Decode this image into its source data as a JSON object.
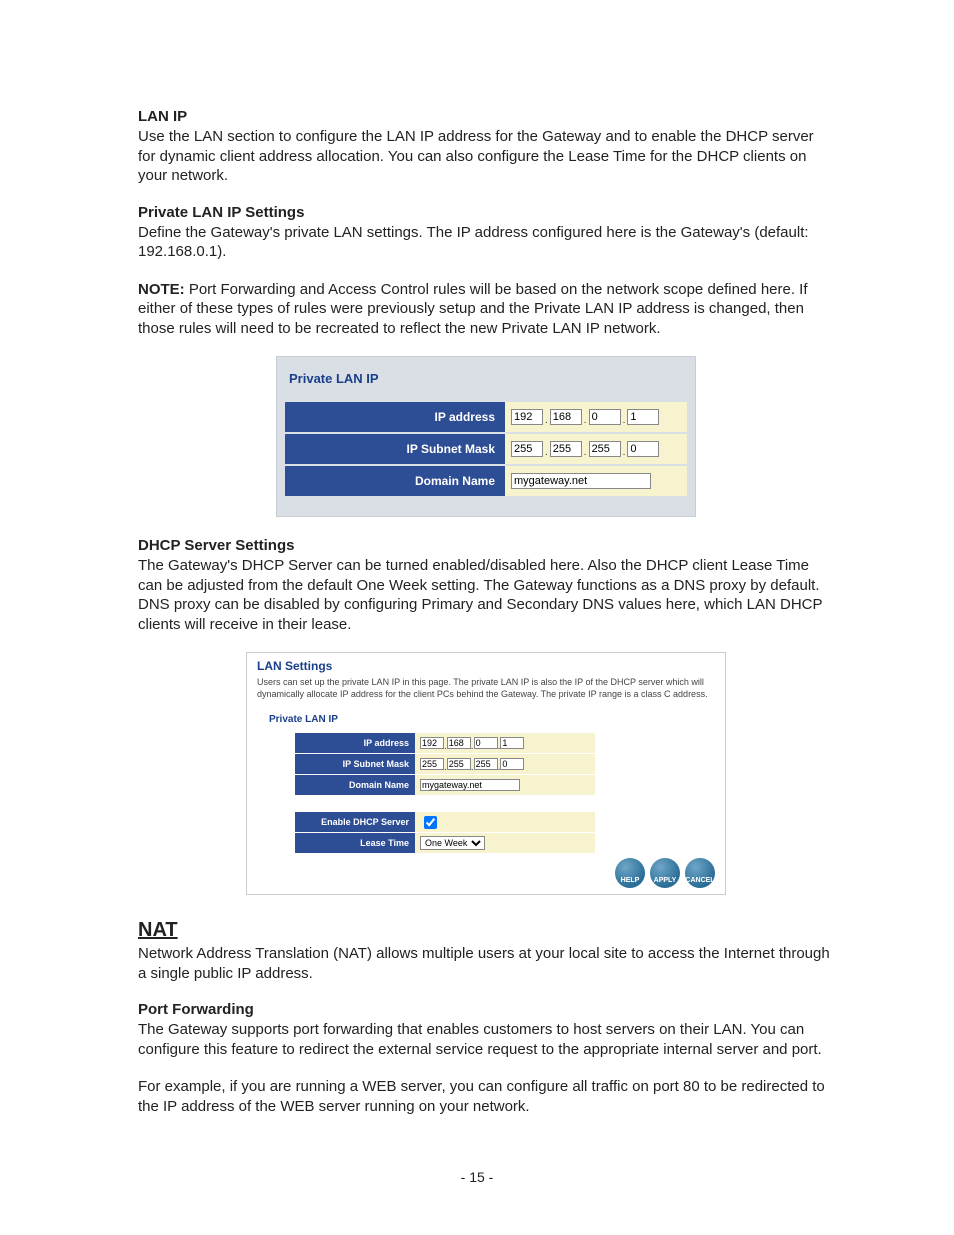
{
  "sections": {
    "lan_ip": {
      "heading": "LAN IP",
      "body": "Use the LAN section to configure the LAN IP address for the Gateway and to enable the DHCP server for dynamic client address allocation. You can also configure the Lease Time for the DHCP clients on your network."
    },
    "private_lan": {
      "heading": "Private LAN IP Settings",
      "body": "Define the Gateway's private LAN settings.  The IP address configured here is the Gateway's (default: 192.168.0.1)."
    },
    "note": {
      "label": "NOTE:",
      "body": " Port Forwarding and Access Control rules will be based on the network scope defined here.  If either of these types of rules were previously setup and the Private LAN IP address is changed, then those rules will need to be recreated to reflect the new Private LAN IP network."
    },
    "dhcp": {
      "heading": "DHCP Server Settings",
      "body": "The Gateway's DHCP Server can be turned enabled/disabled here.  Also the DHCP client Lease Time can be adjusted from the default One Week setting.  The Gateway functions as a DNS proxy by default.  DNS proxy can be disabled by configuring Primary and Secondary DNS values here, which LAN DHCP clients will receive in their lease."
    },
    "nat": {
      "heading": "NAT",
      "body": "Network Address Translation (NAT) allows multiple users at your local site to access the Internet through a single public IP address."
    },
    "portfw": {
      "heading": "Port Forwarding",
      "body1": "The Gateway supports port forwarding that enables customers to host servers on their LAN. You can configure this feature to redirect the external service request to the appropriate internal server and port.",
      "body2": "For example, if you are running a WEB server, you can configure all traffic on port 80 to be redirected to the IP address of the WEB server running on your network."
    }
  },
  "figure1": {
    "title": "Private LAN IP",
    "rows": {
      "ip_label": "IP address",
      "mask_label": "IP Subnet Mask",
      "domain_label": "Domain Name",
      "ip": [
        "192",
        "168",
        "0",
        "1"
      ],
      "mask": [
        "255",
        "255",
        "255",
        "0"
      ],
      "domain": "mygateway.net"
    }
  },
  "figure2": {
    "title": "LAN Settings",
    "desc": "Users can set up the private LAN IP in this page. The private LAN IP is also the IP of the DHCP server which will dynamically allocate IP address for the client PCs behind the Gateway. The private IP range is a class C address.",
    "sub": "Private LAN IP",
    "rows": {
      "ip_label": "IP address",
      "mask_label": "IP Subnet Mask",
      "domain_label": "Domain Name",
      "dhcp_label": "Enable DHCP Server",
      "lease_label": "Lease Time",
      "ip": [
        "192",
        "168",
        "0",
        "1"
      ],
      "mask": [
        "255",
        "255",
        "255",
        "0"
      ],
      "domain": "mygateway.net",
      "dhcp_enabled": true,
      "lease": "One Week"
    },
    "buttons": {
      "help": "HELP",
      "apply": "APPLY",
      "cancel": "CANCEL"
    }
  },
  "page_number": "- 15 -"
}
